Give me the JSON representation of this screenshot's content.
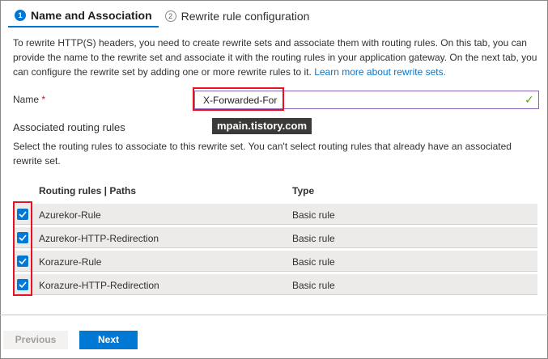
{
  "tabs": [
    {
      "num": "1",
      "label": "Name and Association",
      "active": true
    },
    {
      "num": "2",
      "label": "Rewrite rule configuration",
      "active": false
    }
  ],
  "intro": {
    "text": "To rewrite HTTP(S) headers, you need to create rewrite sets and associate them with routing rules. On this tab, you can provide the name to the rewrite set and associate it with the routing rules in your application gateway. On the next tab, you can configure the rewrite set by adding one or more rewrite rules to it.",
    "link": "Learn more about rewrite sets."
  },
  "name_field": {
    "label": "Name",
    "required_mark": "*",
    "value": "X-Forwarded-For"
  },
  "associated": {
    "title": "Associated routing rules",
    "description": "Select the routing rules to associate to this rewrite set. You can't select routing rules that already have an associated rewrite set."
  },
  "watermark": "mpain.tistory.com",
  "table": {
    "headers": [
      "Routing rules | Paths",
      "Type"
    ],
    "rows": [
      {
        "rule": "Azurekor-Rule",
        "type": "Basic rule",
        "checked": true
      },
      {
        "rule": "Azurekor-HTTP-Redirection",
        "type": "Basic rule",
        "checked": true
      },
      {
        "rule": "Korazure-Rule",
        "type": "Basic rule",
        "checked": true
      },
      {
        "rule": "Korazure-HTTP-Redirection",
        "type": "Basic rule",
        "checked": true
      }
    ]
  },
  "footer": {
    "previous": "Previous",
    "next": "Next"
  },
  "colors": {
    "accent": "#0078d4",
    "highlight": "#e81123",
    "valid": "#57a300"
  }
}
